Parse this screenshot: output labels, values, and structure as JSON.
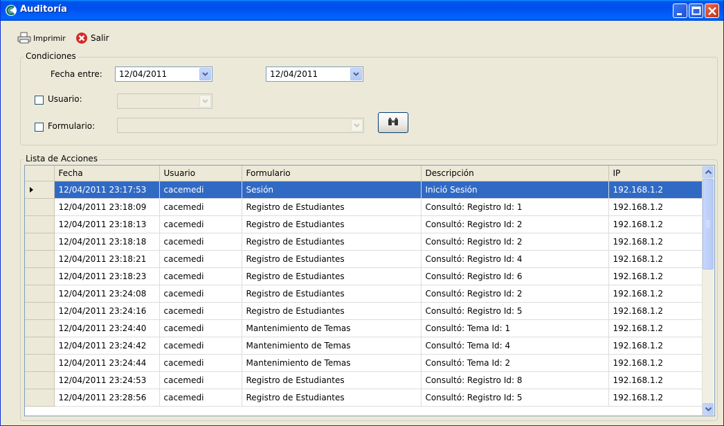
{
  "window": {
    "title": "Auditoría",
    "colors": {
      "titlebar": "#0054e3",
      "selection": "#316ac5",
      "close": "#c1341a"
    }
  },
  "toolbar": {
    "print_label": "Imprimir",
    "exit_label": "Salir"
  },
  "conditions": {
    "legend": "Condiciones",
    "date_label": "Fecha entre:",
    "date_from": "12/04/2011",
    "date_to": "12/04/2011",
    "user_label": "Usuario:",
    "user_checked": false,
    "form_label": "Formulario:",
    "form_checked": false
  },
  "actions": {
    "legend": "Lista de Acciones",
    "columns": [
      "Fecha",
      "Usuario",
      "Formulario",
      "Descripción",
      "IP"
    ],
    "selected_row": 0,
    "rows": [
      [
        "12/04/2011 23:17:53",
        "cacemedi",
        "Sesión",
        "Inició Sesión",
        "192.168.1.2"
      ],
      [
        "12/04/2011 23:18:09",
        "cacemedi",
        "Registro de Estudiantes",
        "Consultó: Registro Id: 1",
        "192.168.1.2"
      ],
      [
        "12/04/2011 23:18:13",
        "cacemedi",
        "Registro de Estudiantes",
        "Consultó: Registro Id: 2",
        "192.168.1.2"
      ],
      [
        "12/04/2011 23:18:18",
        "cacemedi",
        "Registro de Estudiantes",
        "Consultó: Registro Id: 2",
        "192.168.1.2"
      ],
      [
        "12/04/2011 23:18:21",
        "cacemedi",
        "Registro de Estudiantes",
        "Consultó: Registro Id: 4",
        "192.168.1.2"
      ],
      [
        "12/04/2011 23:18:23",
        "cacemedi",
        "Registro de Estudiantes",
        "Consultó: Registro Id: 6",
        "192.168.1.2"
      ],
      [
        "12/04/2011 23:24:08",
        "cacemedi",
        "Registro de Estudiantes",
        "Consultó: Registro Id: 2",
        "192.168.1.2"
      ],
      [
        "12/04/2011 23:24:16",
        "cacemedi",
        "Registro de Estudiantes",
        "Consultó: Registro Id: 5",
        "192.168.1.2"
      ],
      [
        "12/04/2011 23:24:40",
        "cacemedi",
        "Mantenimiento de Temas",
        "Consultó: Tema Id: 1",
        "192.168.1.2"
      ],
      [
        "12/04/2011 23:24:42",
        "cacemedi",
        "Mantenimiento de Temas",
        "Consultó: Tema Id: 4",
        "192.168.1.2"
      ],
      [
        "12/04/2011 23:24:44",
        "cacemedi",
        "Mantenimiento de Temas",
        "Consultó: Tema Id: 2",
        "192.168.1.2"
      ],
      [
        "12/04/2011 23:24:53",
        "cacemedi",
        "Registro de Estudiantes",
        "Consultó: Registro Id: 8",
        "192.168.1.2"
      ],
      [
        "12/04/2011 23:28:56",
        "cacemedi",
        "Registro de Estudiantes",
        "Consultó: Registro Id: 5",
        "192.168.1.2"
      ]
    ]
  }
}
